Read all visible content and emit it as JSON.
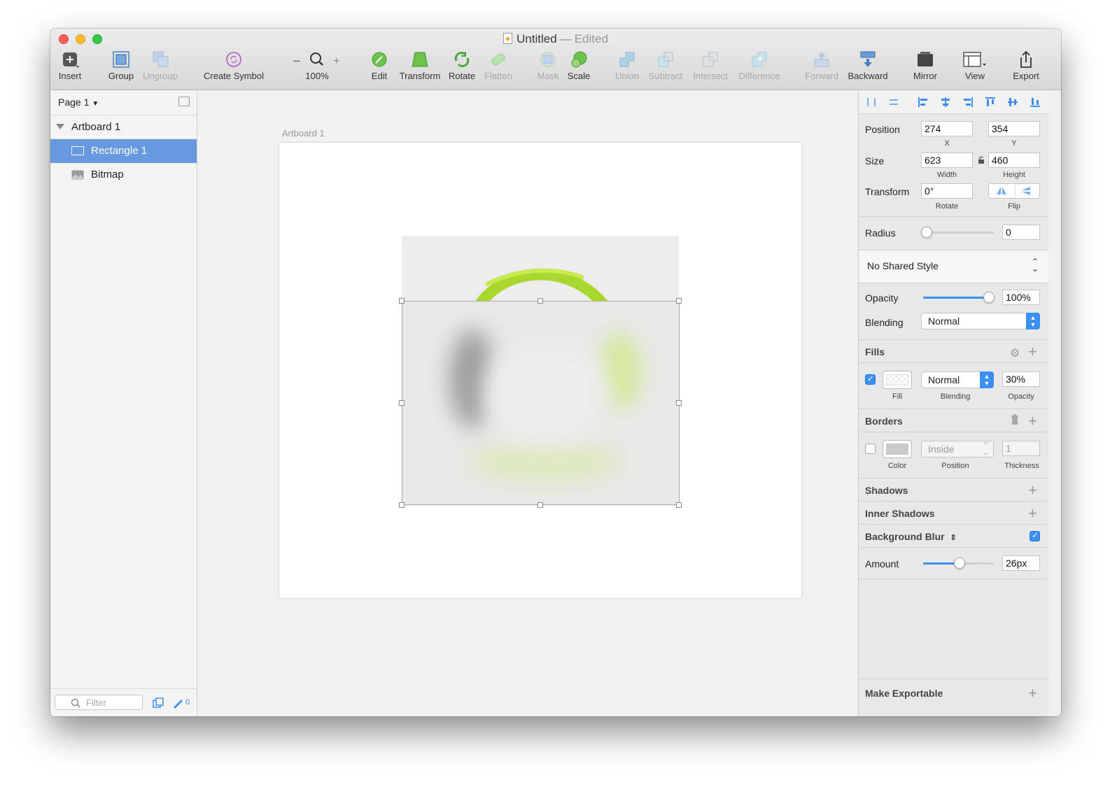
{
  "window": {
    "title": "Untitled",
    "separator": "—",
    "status": "Edited"
  },
  "toolbar": {
    "insert": "Insert",
    "group": "Group",
    "ungroup": "Ungroup",
    "create_symbol": "Create Symbol",
    "zoom_minus": "–",
    "zoom_plus": "+",
    "zoom_level": "100%",
    "edit": "Edit",
    "transform": "Transform",
    "rotate": "Rotate",
    "flatten": "Flatten",
    "mask": "Mask",
    "scale": "Scale",
    "union": "Union",
    "subtract": "Subtract",
    "intersect": "Intersect",
    "difference": "Difference",
    "forward": "Forward",
    "backward": "Backward",
    "mirror": "Mirror",
    "view": "View",
    "export": "Export"
  },
  "sidebar": {
    "page": "Page 1",
    "layers": [
      {
        "label": "Artboard 1"
      },
      {
        "label": "Rectangle 1"
      },
      {
        "label": "Bitmap"
      }
    ],
    "filter_placeholder": "Filter",
    "slice_count": "0"
  },
  "canvas": {
    "artboard_label": "Artboard 1"
  },
  "inspector": {
    "position_label": "Position",
    "x": "274",
    "y": "354",
    "x_label": "X",
    "y_label": "Y",
    "size_label": "Size",
    "width": "623",
    "height": "460",
    "width_label": "Width",
    "height_label": "Height",
    "transform_label": "Transform",
    "rotate_value": "0°",
    "rotate_label": "Rotate",
    "flip_label": "Flip",
    "radius_label": "Radius",
    "radius_value": "0",
    "shared_style": "No Shared Style",
    "opacity_label": "Opacity",
    "opacity_value": "100%",
    "blending_label": "Blending",
    "blending_value": "Normal",
    "fills_title": "Fills",
    "fill_label": "Fill",
    "fill_blending": "Normal",
    "fill_blending_label": "Blending",
    "fill_opacity": "30%",
    "fill_opacity_label": "Opacity",
    "borders_title": "Borders",
    "border_color_label": "Color",
    "border_position": "Inside",
    "border_position_label": "Position",
    "border_thickness": "1",
    "border_thickness_label": "Thickness",
    "shadows_title": "Shadows",
    "inner_shadows_title": "Inner Shadows",
    "background_blur_title": "Background Blur",
    "amount_label": "Amount",
    "amount_value": "26px",
    "make_exportable": "Make Exportable"
  },
  "colors": {
    "accent": "#3b8ff0",
    "selection": "#6699df",
    "lime": "#b5de2a"
  }
}
